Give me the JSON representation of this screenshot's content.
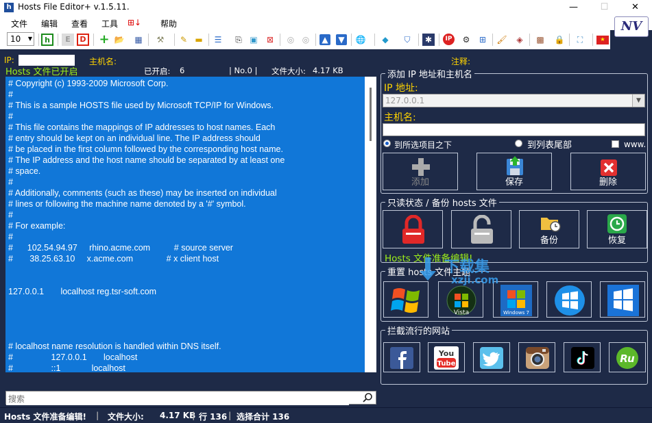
{
  "app": {
    "title": "Hosts File Editor+ v.1.5.11."
  },
  "menu": [
    "文件",
    "编辑",
    "查看",
    "工具",
    "帮助"
  ],
  "toolbar": {
    "font_size": "10"
  },
  "header": {
    "ip_label": "IP:",
    "host_label": "主机名:",
    "comment_label": "注释:",
    "status": "Hosts 文件已开启",
    "enabled_label": "已开启:",
    "enabled_count": "6",
    "no_label": "| No.0 |",
    "filesize_label": "文件大小:",
    "filesize": "4.17 KB"
  },
  "editor": {
    "lines": [
      "# Copyright (c) 1993-2009 Microsoft Corp.",
      "#",
      "# This is a sample HOSTS file used by Microsoft TCP/IP for Windows.",
      "#",
      "# This file contains the mappings of IP addresses to host names. Each",
      "# entry should be kept on an individual line. The IP address should",
      "# be placed in the first column followed by the corresponding host name.",
      "# The IP address and the host name should be separated by at least one",
      "# space.",
      "#",
      "# Additionally, comments (such as these) may be inserted on individual",
      "# lines or following the machine name denoted by a '#' symbol.",
      "#",
      "# For example:",
      "#",
      "#      102.54.94.97     rhino.acme.com          # source server",
      "#       38.25.63.10     x.acme.com              # x client host",
      "",
      "",
      "127.0.0.1       localhost reg.tsr-soft.com",
      "",
      "",
      "",
      "",
      "# localhost name resolution is handled within DNS itself.",
      "#                127.0.0.1       localhost",
      "#                ::1             localhost"
    ]
  },
  "search": {
    "placeholder": "搜索"
  },
  "statusbar": {
    "status": "Hosts 文件准备编辑!",
    "size_label": "文件大小:",
    "size": "4.17 KB",
    "lines": "行 136",
    "selected": "选择合计 136"
  },
  "add_panel": {
    "title": "添加 IP 地址和主机名",
    "ip_label": "IP 地址:",
    "ip_value": "127.0.0.1",
    "host_label": "主机名:",
    "host_value": "",
    "radio_below": "到所选项目之下",
    "radio_end": "到列表尾部",
    "www_label": "www.",
    "btn_add": "添加",
    "btn_save": "保存",
    "btn_delete": "删除"
  },
  "readonly_panel": {
    "title": "只读状态 / 备份 hosts 文件",
    "btn_backup": "备份",
    "btn_restore": "恢复",
    "status": "Hosts 文件准备编辑!"
  },
  "reset_panel": {
    "title": "重置 hosts 文件主题",
    "os": [
      "Windows XP",
      "Vista",
      "Windows 7",
      "Windows 8",
      "Windows 10, 11"
    ]
  },
  "block_panel": {
    "title": "拦截流行的网站",
    "sites": [
      "facebook-icon",
      "youtube-icon",
      "twitter-icon",
      "instagram-icon",
      "tiktok-icon",
      "vk-icon"
    ]
  },
  "watermark": {
    "text": "下载集",
    "url": "xzji.com"
  },
  "colors": {
    "bg": "#1e2a47",
    "editor_bg": "#1177d8",
    "label_yellow": "#ffd400",
    "status_green": "#9ef01a"
  }
}
